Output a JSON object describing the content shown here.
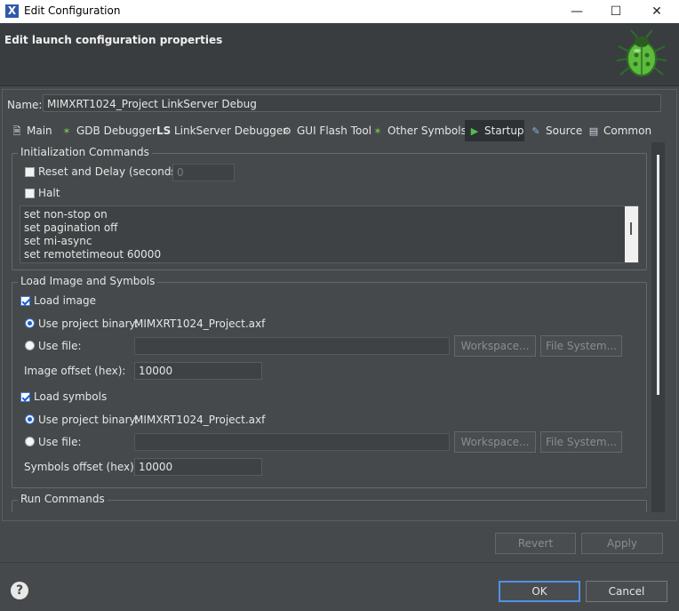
{
  "window": {
    "title": "Edit Configuration",
    "app_icon_glyph": "X",
    "minimize_glyph": "—",
    "maximize_glyph": "☐",
    "close_glyph": "✕"
  },
  "header": {
    "title": "Edit launch configuration properties",
    "icon": "bug-icon"
  },
  "name_row": {
    "label": "Name:",
    "value": "MIMXRT1024_Project LinkServer Debug"
  },
  "tabs": [
    {
      "label": "Main",
      "icon": "document-icon",
      "glyph": "🗎"
    },
    {
      "label": "GDB Debugger",
      "icon": "bug-small-icon",
      "glyph": "✶"
    },
    {
      "label": "LinkServer Debugger",
      "icon": "ls-icon",
      "glyph": "LS"
    },
    {
      "label": "GUI Flash Tool",
      "icon": "chip-icon",
      "glyph": "⚙"
    },
    {
      "label": "Other Symbols",
      "icon": "bug-small-icon",
      "glyph": "✶"
    },
    {
      "label": "Startup",
      "icon": "play-icon",
      "glyph": "▶",
      "active": true
    },
    {
      "label": "Source",
      "icon": "source-icon",
      "glyph": "✎"
    },
    {
      "label": "Common",
      "icon": "common-icon",
      "glyph": "▤"
    }
  ],
  "init": {
    "group_label": "Initialization Commands",
    "reset_label": "Reset and Delay (seconds):",
    "reset_checked": false,
    "reset_value": "0",
    "halt_label": "Halt",
    "halt_checked": false,
    "commands": [
      "set non-stop on",
      "set pagination off",
      "set mi-async",
      "set remotetimeout 60000"
    ]
  },
  "load": {
    "group_label": "Load Image and Symbols",
    "load_image_label": "Load image",
    "load_image_checked": true,
    "image_use_project_label": "Use project binary:",
    "image_project_binary": "MIMXRT1024_Project.axf",
    "image_use_file_label": "Use file:",
    "image_file_value": "",
    "workspace_label": "Workspace...",
    "filesystem_label": "File System...",
    "image_offset_label": "Image offset (hex):",
    "image_offset_value": "10000",
    "load_symbols_label": "Load symbols",
    "load_symbols_checked": true,
    "symbols_use_project_label": "Use project binary:",
    "symbols_project_binary": "MIMXRT1024_Project.axf",
    "symbols_use_file_label": "Use file:",
    "symbols_file_value": "",
    "symbols_offset_label": "Symbols offset (hex):",
    "symbols_offset_value": "10000"
  },
  "run": {
    "group_label": "Run Commands"
  },
  "buttons": {
    "revert": "Revert",
    "apply": "Apply",
    "ok": "OK",
    "cancel": "Cancel",
    "help_glyph": "?"
  },
  "colors": {
    "background": "#46494b",
    "header": "#3a3d3f",
    "accent": "#4d93e6",
    "active_tab": "#2e3133"
  }
}
